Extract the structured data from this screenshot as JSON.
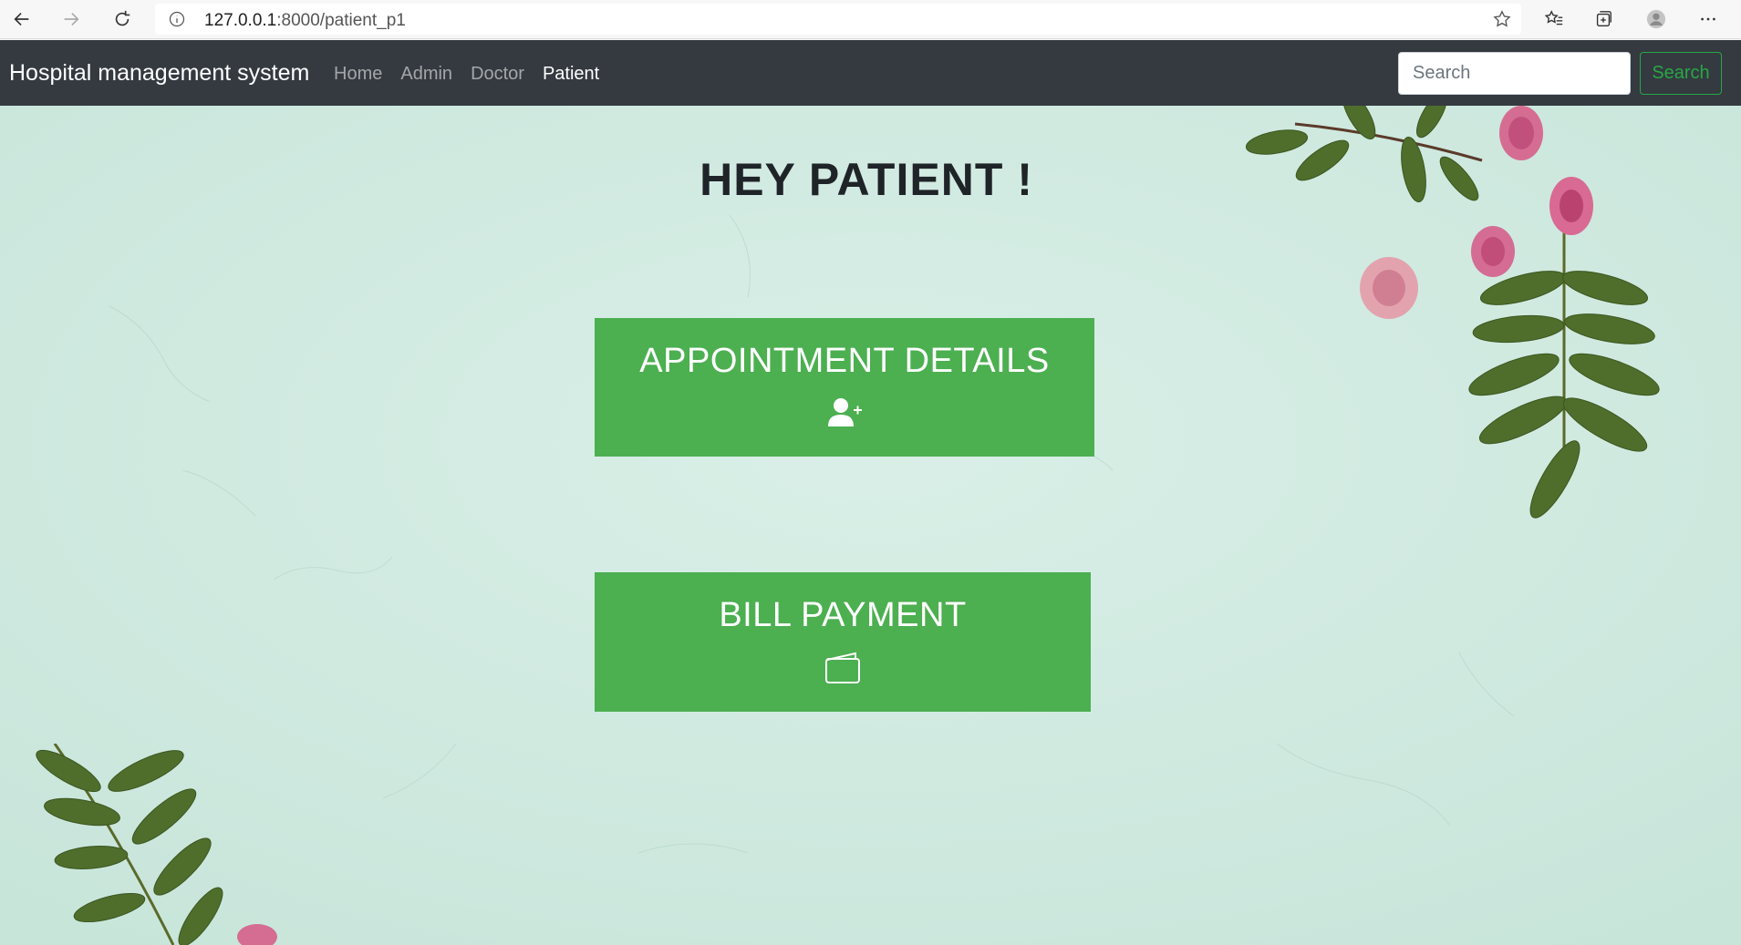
{
  "browser": {
    "url_host": "127.0.0.1",
    "url_path": ":8000/patient_p1",
    "icons": [
      "back-arrow-icon",
      "forward-arrow-icon",
      "refresh-icon",
      "info-icon",
      "star-icon",
      "favorites-icon",
      "collections-icon",
      "profile-avatar-icon",
      "more-options-icon"
    ]
  },
  "navbar": {
    "brand": "Hospital management system",
    "links": [
      {
        "label": "Home",
        "active": false
      },
      {
        "label": "Admin",
        "active": false
      },
      {
        "label": "Doctor",
        "active": false
      },
      {
        "label": "Patient",
        "active": true
      }
    ],
    "search_placeholder": "Search",
    "search_button": "Search",
    "colors": {
      "background": "#343a40",
      "search_accent": "#28a745"
    }
  },
  "main": {
    "heading": "HEY PATIENT !",
    "tiles": [
      {
        "label": "APPOINTMENT DETAILS",
        "icon": "add-user-icon"
      },
      {
        "label": "BILL PAYMENT",
        "icon": "wallet-icon"
      }
    ],
    "colors": {
      "tile": "#4caf50",
      "background": "#d3ebe2"
    }
  }
}
